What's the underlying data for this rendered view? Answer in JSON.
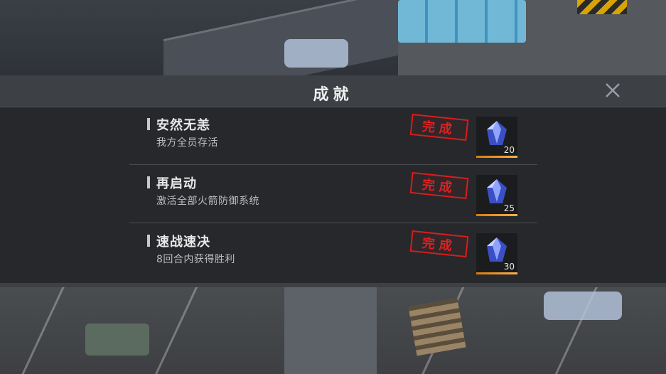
{
  "modal": {
    "title": "成就",
    "close_icon": "close-icon"
  },
  "achievements": [
    {
      "title": "安然无恙",
      "description": "我方全员存活",
      "status": "完成",
      "reward_icon": "crystal-icon",
      "reward_count": "20"
    },
    {
      "title": "再启动",
      "description": "激活全部火箭防御系统",
      "status": "完成",
      "reward_icon": "crystal-icon",
      "reward_count": "25"
    },
    {
      "title": "速战速决",
      "description": "8回合内获得胜利",
      "status": "完成",
      "reward_icon": "crystal-icon",
      "reward_count": "30"
    }
  ],
  "colors": {
    "stamp_red": "#d61d1d",
    "reward_accent": "#f09a2a",
    "panel_bg": "#26282b",
    "title_bar_bg": "#3d4044"
  }
}
